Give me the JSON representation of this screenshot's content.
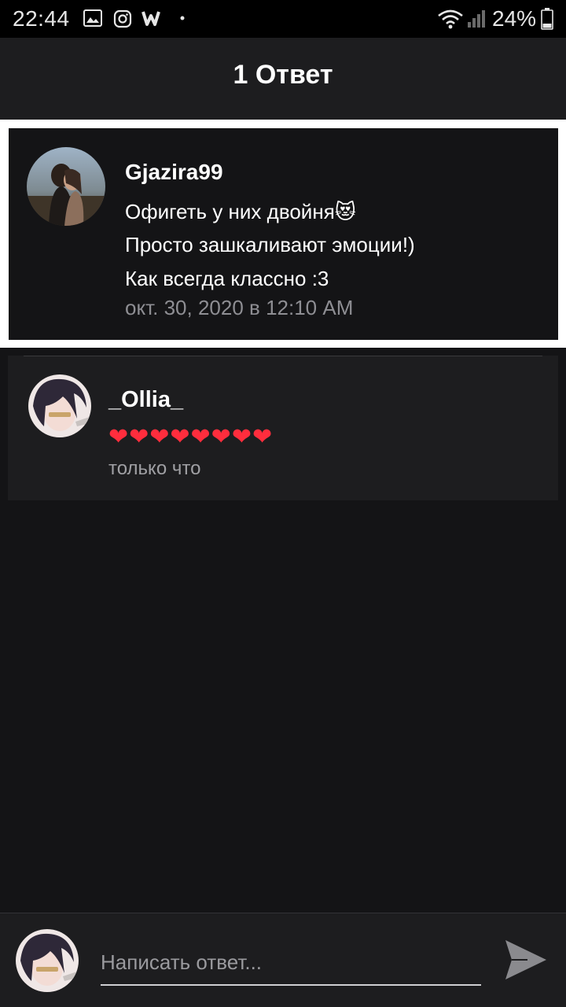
{
  "status_bar": {
    "time": "22:44",
    "battery": "24%",
    "icons": [
      "gallery-icon",
      "instagram-icon",
      "webtoon-icon",
      "dot-icon",
      "wifi-icon",
      "signal-icon",
      "battery-icon"
    ]
  },
  "header": {
    "title": "1 Ответ"
  },
  "parent_comment": {
    "avatar": "avatar",
    "username": "Gjazira99",
    "lines": [
      "Офигеть у них двойня😻",
      "Просто зашкаливают эмоции!)",
      "Как всегда классно :3"
    ],
    "timestamp": "окт. 30, 2020 в 12:10 AM"
  },
  "reply": {
    "avatar": "avatar",
    "username": "_Ollia_",
    "text": "❤❤❤❤❤❤❤❤",
    "timestamp": "только что"
  },
  "composer": {
    "placeholder": "Написать ответ...",
    "send_icon": "send-icon"
  },
  "colors": {
    "background": "#141416",
    "card": "#1d1d1f",
    "highlight_border": "#ffffff",
    "heart": "#ff2d3d",
    "secondary_text": "#8e8e93"
  }
}
